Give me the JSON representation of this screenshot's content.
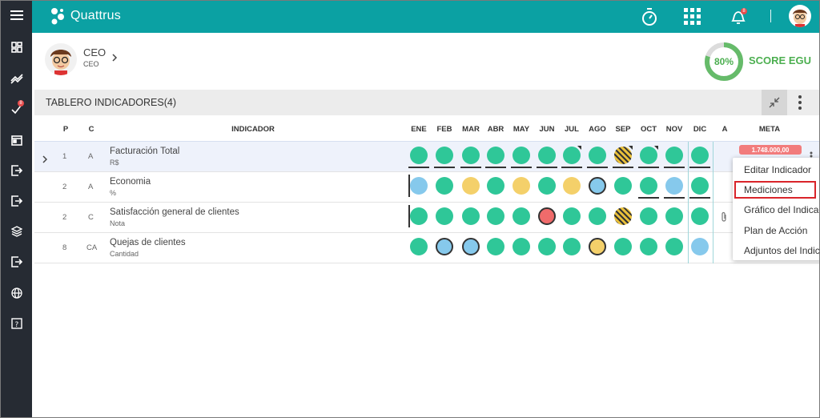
{
  "app": {
    "brand": "Quattrus",
    "notification_count": "8"
  },
  "sidebar": {
    "items": [
      "menu-icon",
      "dashboard-icon",
      "trend-icon",
      "checklist-icon",
      "calendar-icon",
      "exit-icon",
      "exit-icon-2",
      "layers-icon",
      "exit-icon-3",
      "globe-icon",
      "help-icon"
    ],
    "badge": "8"
  },
  "profile": {
    "name": "CEO",
    "role": "CEO"
  },
  "score": {
    "value": "80%",
    "label": "SCORE EGU",
    "percent": 80
  },
  "panel": {
    "title": "TABLERO INDICADORES(4)"
  },
  "table": {
    "headers": {
      "p": "P",
      "c": "C",
      "indicator": "INDICADOR",
      "a": "A",
      "meta": "META"
    },
    "months": [
      "ENE",
      "FEB",
      "MAR",
      "ABR",
      "MAY",
      "JUN",
      "JUL",
      "AGO",
      "SEP",
      "OCT",
      "NOV",
      "DIC"
    ],
    "rows": [
      {
        "p": "1",
        "c": "A",
        "name": "Facturación Total",
        "unit": "R$"
      },
      {
        "p": "2",
        "c": "A",
        "name": "Economia",
        "unit": "%"
      },
      {
        "p": "2",
        "c": "C",
        "name": "Satisfacción general de clientes",
        "unit": "Nota"
      },
      {
        "p": "8",
        "c": "CA",
        "name": "Quejas de clientes",
        "unit": "Cantidad"
      }
    ],
    "meta_value": "1.748.000,00"
  },
  "context_menu": {
    "items": [
      "Editar Indicador",
      "Mediciones",
      "Gráfico del Indicador",
      "Plan de Acción",
      "Adjuntos del Indicador"
    ],
    "highlighted": "Mediciones"
  },
  "colors": {
    "green": "#2fc798",
    "blue": "#86c9ec",
    "yellow": "#f4d06a",
    "red": "#f06b6b",
    "teal": "#0ba1a3"
  }
}
